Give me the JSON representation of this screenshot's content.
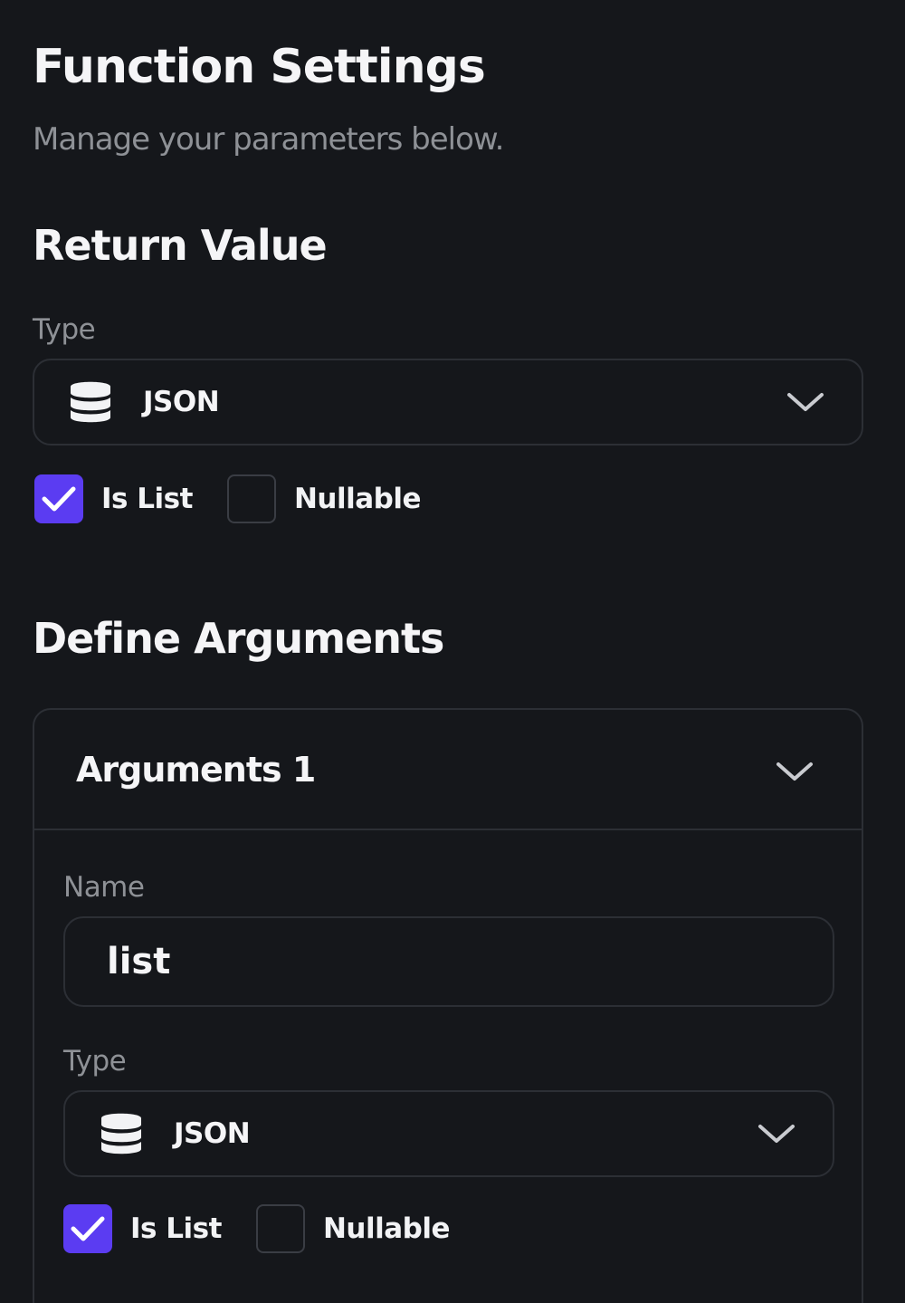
{
  "header": {
    "title": "Function Settings",
    "subtitle": "Manage your parameters below."
  },
  "return_value": {
    "section_title": "Return Value",
    "type_label": "Type",
    "type_value": "JSON",
    "type_icon": "database-icon",
    "is_list_label": "Is List",
    "is_list_checked": true,
    "nullable_label": "Nullable",
    "nullable_checked": false
  },
  "arguments": {
    "section_title": "Define Arguments",
    "items": [
      {
        "title": "Arguments 1",
        "name_label": "Name",
        "name_value": "list",
        "type_label": "Type",
        "type_value": "JSON",
        "type_icon": "database-icon",
        "is_list_label": "Is List",
        "is_list_checked": true,
        "nullable_label": "Nullable",
        "nullable_checked": false
      }
    ]
  },
  "colors": {
    "background": "#15171b",
    "border": "#2c2f35",
    "accent": "#5b3cf2",
    "muted_text": "#8e9196",
    "text": "#f5f5f7"
  }
}
